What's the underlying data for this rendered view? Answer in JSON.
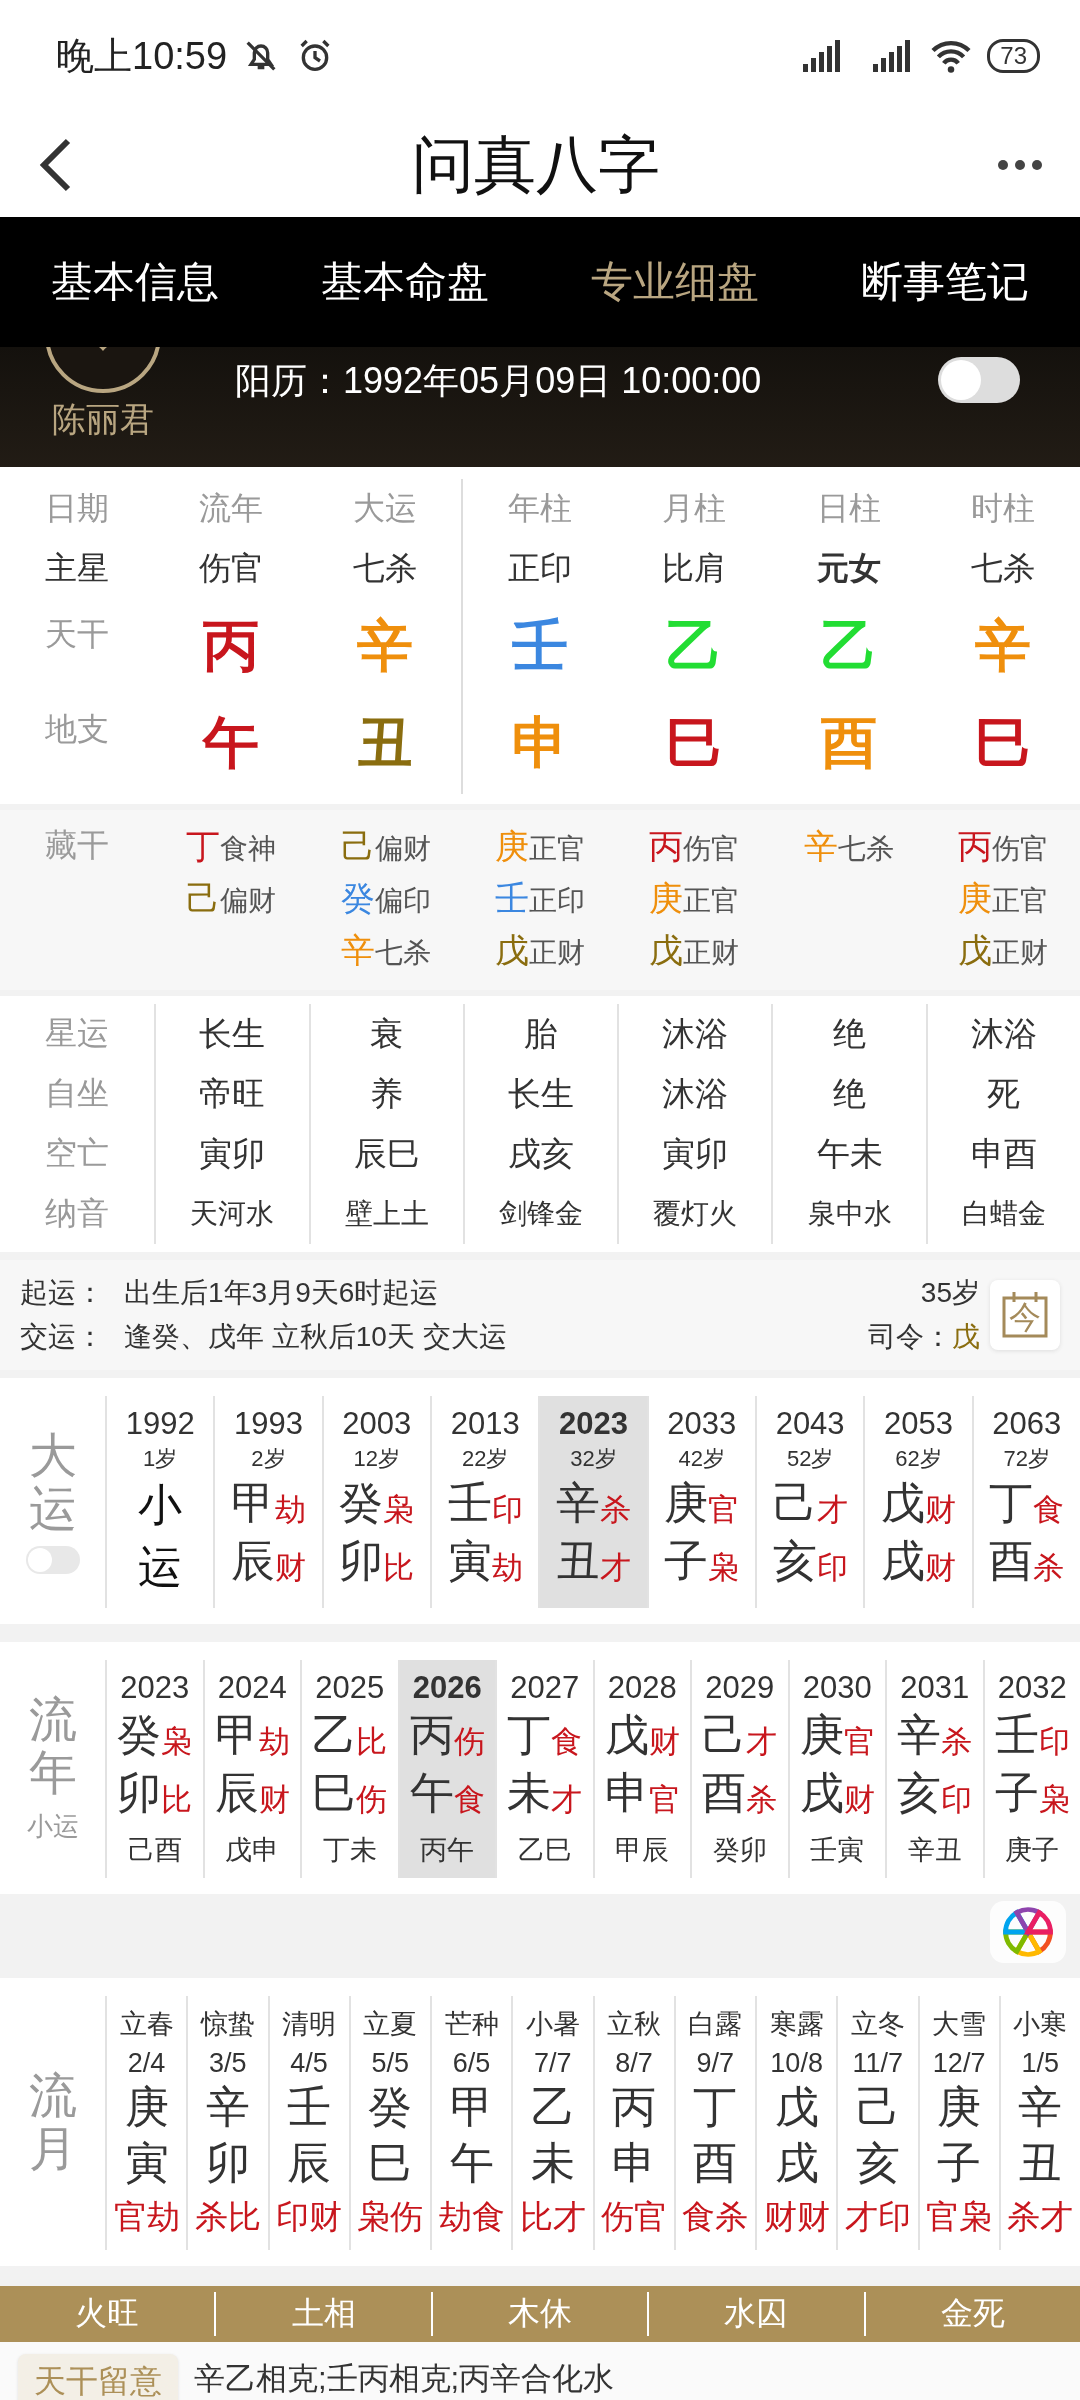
{
  "status_bar": {
    "time": "晚上10:59",
    "battery": "73"
  },
  "header": {
    "title": "问真八字"
  },
  "tabs": [
    {
      "label": "基本信息",
      "selected": false
    },
    {
      "label": "基本命盘",
      "selected": false
    },
    {
      "label": "专业细盘",
      "selected": true
    },
    {
      "label": "断事笔记",
      "selected": false
    }
  ],
  "profile": {
    "name": "陈丽君",
    "solar_date": "阳历：1992年05月09日 10:00:00",
    "toggle_on": false
  },
  "row_labels": {
    "date": "日期",
    "star": "主星",
    "stem": "天干",
    "branch": "地支",
    "hidden": "藏干",
    "xingyun": "星运",
    "zizuo": "自坐",
    "kongwang": "空亡",
    "nayin": "纳音"
  },
  "pillars": [
    {
      "header": "流年",
      "star": "伤官",
      "star_bold": false,
      "stem": {
        "char": "丙",
        "color": "#c8161d"
      },
      "branch": {
        "char": "午",
        "color": "#c8161d"
      },
      "hidden": [
        {
          "char": "丁",
          "color": "#c8161d",
          "god": "食神"
        },
        {
          "char": "己",
          "color": "#8a6d0f",
          "god": "偏财"
        }
      ],
      "xingyun": "长生",
      "zizuo": "帝旺",
      "kongwang": "寅卯",
      "nayin": "天河水"
    },
    {
      "header": "大运",
      "star": "七杀",
      "star_bold": false,
      "stem": {
        "char": "辛",
        "color": "#ef8f0c"
      },
      "branch": {
        "char": "丑",
        "color": "#8a6d0f"
      },
      "hidden": [
        {
          "char": "己",
          "color": "#8a6d0f",
          "god": "偏财"
        },
        {
          "char": "癸",
          "color": "#3b87e0",
          "god": "偏印"
        },
        {
          "char": "辛",
          "color": "#ef8f0c",
          "god": "七杀"
        }
      ],
      "xingyun": "衰",
      "zizuo": "养",
      "kongwang": "辰巳",
      "nayin": "壁上土"
    },
    {
      "header": "年柱",
      "star": "正印",
      "star_bold": false,
      "stem": {
        "char": "壬",
        "color": "#3b87e0"
      },
      "branch": {
        "char": "申",
        "color": "#ef8f0c"
      },
      "hidden": [
        {
          "char": "庚",
          "color": "#ef8f0c",
          "god": "正官"
        },
        {
          "char": "壬",
          "color": "#3b87e0",
          "god": "正印"
        },
        {
          "char": "戊",
          "color": "#8a6d0f",
          "god": "正财"
        }
      ],
      "xingyun": "胎",
      "zizuo": "长生",
      "kongwang": "戌亥",
      "nayin": "剑锋金"
    },
    {
      "header": "月柱",
      "star": "比肩",
      "star_bold": false,
      "stem": {
        "char": "乙",
        "color": "#22dd33"
      },
      "branch": {
        "char": "巳",
        "color": "#c8161d"
      },
      "hidden": [
        {
          "char": "丙",
          "color": "#c8161d",
          "god": "伤官"
        },
        {
          "char": "庚",
          "color": "#ef8f0c",
          "god": "正官"
        },
        {
          "char": "戊",
          "color": "#8a6d0f",
          "god": "正财"
        }
      ],
      "xingyun": "沐浴",
      "zizuo": "沐浴",
      "kongwang": "寅卯",
      "nayin": "覆灯火"
    },
    {
      "header": "日柱",
      "star": "元女",
      "star_bold": true,
      "stem": {
        "char": "乙",
        "color": "#22dd33"
      },
      "branch": {
        "char": "酉",
        "color": "#ef8f0c"
      },
      "hidden": [
        {
          "char": "辛",
          "color": "#ef8f0c",
          "god": "七杀"
        }
      ],
      "xingyun": "绝",
      "zizuo": "绝",
      "kongwang": "午未",
      "nayin": "泉中水"
    },
    {
      "header": "时柱",
      "star": "七杀",
      "star_bold": false,
      "stem": {
        "char": "辛",
        "color": "#ef8f0c"
      },
      "branch": {
        "char": "巳",
        "color": "#c8161d"
      },
      "hidden": [
        {
          "char": "丙",
          "color": "#c8161d",
          "god": "伤官"
        },
        {
          "char": "庚",
          "color": "#ef8f0c",
          "god": "正官"
        },
        {
          "char": "戊",
          "color": "#8a6d0f",
          "god": "正财"
        }
      ],
      "xingyun": "沐浴",
      "zizuo": "死",
      "kongwang": "申酉",
      "nayin": "白蜡金"
    }
  ],
  "qiyun": {
    "start_label": "起运：",
    "start_text": "出生后1年3月9天6时起运",
    "change_label": "交运：",
    "change_text": "逢癸、戊年 立秋后10天 交大运",
    "age": "35岁",
    "siling_label": "司令：",
    "siling_value": "戊",
    "today_icon": "今"
  },
  "dayun": {
    "label": "大运",
    "toggle_on": false,
    "items": [
      {
        "kind": "xiaoyun",
        "year": "1992",
        "age": "1岁",
        "stem": "小",
        "branch": "运",
        "selected": false
      },
      {
        "kind": "yun",
        "year": "1993",
        "age": "2岁",
        "stem": "甲",
        "stem_god": "劫",
        "branch": "辰",
        "branch_god": "财",
        "selected": false
      },
      {
        "kind": "yun",
        "year": "2003",
        "age": "12岁",
        "stem": "癸",
        "stem_god": "枭",
        "branch": "卯",
        "branch_god": "比",
        "selected": false
      },
      {
        "kind": "yun",
        "year": "2013",
        "age": "22岁",
        "stem": "壬",
        "stem_god": "印",
        "branch": "寅",
        "branch_god": "劫",
        "selected": false
      },
      {
        "kind": "yun",
        "year": "2023",
        "age": "32岁",
        "stem": "辛",
        "stem_god": "杀",
        "branch": "丑",
        "branch_god": "才",
        "selected": true
      },
      {
        "kind": "yun",
        "year": "2033",
        "age": "42岁",
        "stem": "庚",
        "stem_god": "官",
        "branch": "子",
        "branch_god": "枭",
        "selected": false
      },
      {
        "kind": "yun",
        "year": "2043",
        "age": "52岁",
        "stem": "己",
        "stem_god": "才",
        "branch": "亥",
        "branch_god": "印",
        "selected": false
      },
      {
        "kind": "yun",
        "year": "2053",
        "age": "62岁",
        "stem": "戊",
        "stem_god": "财",
        "branch": "戌",
        "branch_god": "财",
        "selected": false
      },
      {
        "kind": "yun",
        "year": "2063",
        "age": "72岁",
        "stem": "丁",
        "stem_god": "食",
        "branch": "酉",
        "branch_god": "杀",
        "selected": false
      }
    ]
  },
  "liunian": {
    "label": "流年",
    "sublabel": "小运",
    "items": [
      {
        "year": "2023",
        "stem": "癸",
        "stem_god": "枭",
        "branch": "卯",
        "branch_god": "比",
        "xiaoyun": "己酉",
        "selected": false
      },
      {
        "year": "2024",
        "stem": "甲",
        "stem_god": "劫",
        "branch": "辰",
        "branch_god": "财",
        "xiaoyun": "戊申",
        "selected": false
      },
      {
        "year": "2025",
        "stem": "乙",
        "stem_god": "比",
        "branch": "巳",
        "branch_god": "伤",
        "xiaoyun": "丁未",
        "selected": false
      },
      {
        "year": "2026",
        "stem": "丙",
        "stem_god": "伤",
        "branch": "午",
        "branch_god": "食",
        "xiaoyun": "丙午",
        "selected": true
      },
      {
        "year": "2027",
        "stem": "丁",
        "stem_god": "食",
        "branch": "未",
        "branch_god": "才",
        "xiaoyun": "乙巳",
        "selected": false
      },
      {
        "year": "2028",
        "stem": "戊",
        "stem_god": "财",
        "branch": "申",
        "branch_god": "官",
        "xiaoyun": "甲辰",
        "selected": false
      },
      {
        "year": "2029",
        "stem": "己",
        "stem_god": "才",
        "branch": "酉",
        "branch_god": "杀",
        "xiaoyun": "癸卯",
        "selected": false
      },
      {
        "year": "2030",
        "stem": "庚",
        "stem_god": "官",
        "branch": "戌",
        "branch_god": "财",
        "xiaoyun": "壬寅",
        "selected": false
      },
      {
        "year": "2031",
        "stem": "辛",
        "stem_god": "杀",
        "branch": "亥",
        "branch_god": "印",
        "xiaoyun": "辛丑",
        "selected": false
      },
      {
        "year": "2032",
        "stem": "壬",
        "stem_god": "印",
        "branch": "子",
        "branch_god": "枭",
        "xiaoyun": "庚子",
        "selected": false
      }
    ]
  },
  "liuyue": {
    "label": "流月",
    "items": [
      {
        "term": "立春",
        "date": "2/4",
        "stem": "庚",
        "branch": "寅",
        "gods": "官劫"
      },
      {
        "term": "惊蛰",
        "date": "3/5",
        "stem": "辛",
        "branch": "卯",
        "gods": "杀比"
      },
      {
        "term": "清明",
        "date": "4/5",
        "stem": "壬",
        "branch": "辰",
        "gods": "印财"
      },
      {
        "term": "立夏",
        "date": "5/5",
        "stem": "癸",
        "branch": "巳",
        "gods": "枭伤"
      },
      {
        "term": "芒种",
        "date": "6/5",
        "stem": "甲",
        "branch": "午",
        "gods": "劫食"
      },
      {
        "term": "小暑",
        "date": "7/7",
        "stem": "乙",
        "branch": "未",
        "gods": "比才"
      },
      {
        "term": "立秋",
        "date": "8/7",
        "stem": "丙",
        "branch": "申",
        "gods": "伤官"
      },
      {
        "term": "白露",
        "date": "9/7",
        "stem": "丁",
        "branch": "酉",
        "gods": "食杀"
      },
      {
        "term": "寒露",
        "date": "10/8",
        "stem": "戊",
        "branch": "戌",
        "gods": "财财"
      },
      {
        "term": "立冬",
        "date": "11/7",
        "stem": "己",
        "branch": "亥",
        "gods": "才印"
      },
      {
        "term": "大雪",
        "date": "12/7",
        "stem": "庚",
        "branch": "子",
        "gods": "官枭"
      },
      {
        "term": "小寒",
        "date": "1/5",
        "stem": "辛",
        "branch": "丑",
        "gods": "杀才"
      }
    ]
  },
  "wuxing": [
    "火旺",
    "土相",
    "木休",
    "水囚",
    "金死"
  ],
  "notice": {
    "tag": "天干留意",
    "text": "辛乙相克;壬丙相克;丙辛合化水"
  }
}
